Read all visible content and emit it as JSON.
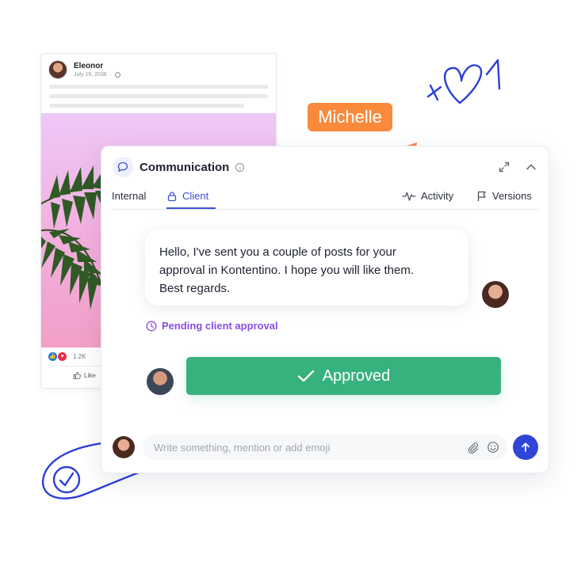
{
  "post": {
    "author": "Eleonor",
    "date": "July 19, 2036",
    "separator": "·",
    "reactions_count": "1.2K",
    "like_label": "Like"
  },
  "tag": {
    "name": "Michelle"
  },
  "panel": {
    "title": "Communication",
    "tabs": [
      {
        "label": "Internal",
        "active": false
      },
      {
        "label": "Client",
        "active": true
      }
    ],
    "actions": [
      {
        "label": "Activity",
        "icon": "activity-icon"
      },
      {
        "label": "Versions",
        "icon": "flag-icon"
      }
    ],
    "message": {
      "lines": [
        "Hello, I've sent you a couple of posts for your",
        "approval in Kontentino. I hope you will like them.",
        "Best regards."
      ]
    },
    "status": "Pending client approval",
    "approved_button": "Approved",
    "composer": {
      "placeholder": "Write something, mention or add emoji"
    }
  },
  "colors": {
    "accent": "#3d4fd6",
    "approved": "#38b27c",
    "pending": "#8a4de0",
    "tag": "#f98a3c",
    "doodle": "#2b3fd6"
  }
}
